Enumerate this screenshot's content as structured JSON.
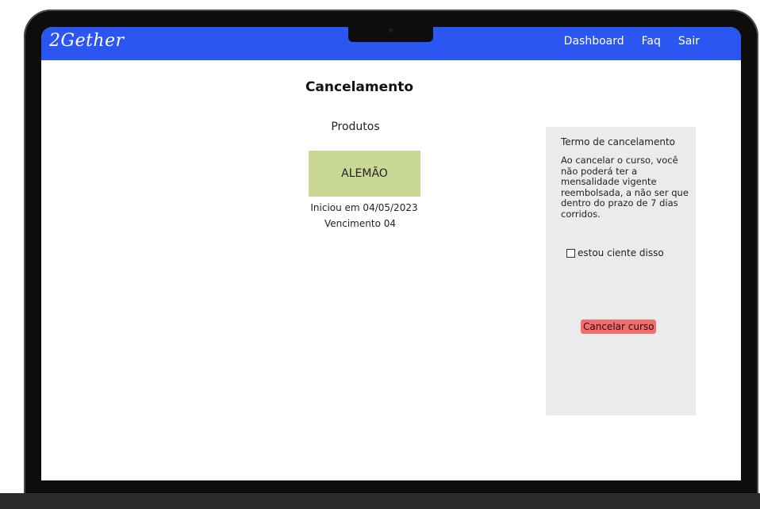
{
  "app": {
    "brand": "2Gether"
  },
  "nav": {
    "items": [
      {
        "label": "Dashboard"
      },
      {
        "label": "Faq"
      },
      {
        "label": "Sair"
      }
    ]
  },
  "main": {
    "title": "Cancelamento",
    "section_label": "Produtos",
    "product": {
      "name": "ALEMÃO",
      "start": "Iniciou em 04/05/2023",
      "due": "Vencimento 04"
    }
  },
  "panel": {
    "title": "Termo de cancelamento",
    "text": "Ao cancelar o curso, você não poderá ter a mensalidade vigente reembolsada, a não ser que dentro do prazo de 7 dias corridos.",
    "checkbox_label": "estou ciente disso",
    "checkbox_checked": false,
    "button_label": "Cancelar curso"
  },
  "colors": {
    "navbar": "#2c56f2",
    "product_card": "#c9d895",
    "panel_bg": "#ebebeb",
    "cancel_button": "#f26d6d"
  }
}
